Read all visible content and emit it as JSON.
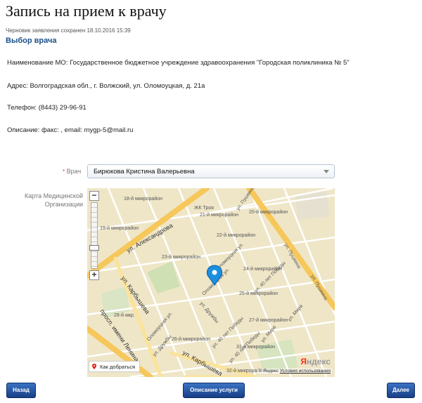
{
  "page": {
    "title": "Запись на прием к врачу",
    "draft_note": "Черновик заявления сохранен 18.10.2016 15:39",
    "section_title": "Выбор врача"
  },
  "clinic": {
    "name_line": "Наименование МО: Государственное бюджетное учреждение здравоохранения \"Городская поликлиника № 5\"",
    "address_line": "Адрес: Волгоградская обл., г. Волжский, ул. Оломоуцкая, д. 21а",
    "phone_line": "Телефон: (8443) 29-96-91",
    "description_line": "Описание: факс: , email: mygp-5@mail.ru"
  },
  "doctor_field": {
    "required_mark": "*",
    "label": "Врач",
    "value": "Бирюкова Кристина Валерьевна"
  },
  "map_section": {
    "label_line1": "Карта Медицинской",
    "label_line2": "Организации",
    "zoom_in": "+",
    "zoom_out": "−",
    "zoom_level_fraction": 0.7,
    "route_label": "Как добраться",
    "provider_prefix": "Я",
    "provider_rest": "ндекс",
    "copyright": "© Яндекс",
    "terms": "Условия использования",
    "labels": {
      "mkr18": "18-й микрорайон",
      "troya": "ЖК Троя",
      "mkr21": "21-й микрорайон",
      "mkr20": "20-й микрорайон",
      "mkr22": "22-й микрорайон",
      "mkr19": "19-й микрорайон",
      "mkr23": "23-й микрорайон",
      "mkr24": "24-й микрорайон",
      "mkr25": "25-й микрорайон",
      "mkr28": "28-й мкр.",
      "mkr27": "27-й микрорайон",
      "mkr26": "26-й микрорайон",
      "mkr31": "31-й микрорайон",
      "mkr32": "32-й микрорайон",
      "st_alexandrova": "ул. Александрова",
      "st_karbysheva": "ул. Карбышева",
      "st_karbysheva2": "ул. Карбышева",
      "st_lenina": "просп. имени Ленина",
      "st_pushkina": "ул. Пушкина",
      "st_pushkina2": "ул. Пушкина",
      "st_pushkina3": "ул. Пушкина",
      "st_olomouc": "Оломоуцкая ул.",
      "st_olomouc2": "Оломоуцкая ул.",
      "st_olomouc3": "Оломоуцкая ул.",
      "st_pobedy": "ул. 40 лет Победы",
      "st_pobedy2": "ул. 40 лет Победы",
      "st_pobedy3": "ул. 40 лет Победы",
      "st_druzhby": "ул. Дружбы",
      "st_druzhby2": "ул. Дружбы",
      "st_mira": "ул. Мира",
      "st_mira2": "ул. Мира"
    }
  },
  "buttons": {
    "back": "Назад",
    "service_description": "Описание услуги",
    "next": "Далее"
  },
  "colors": {
    "section_title": "#1b4f8a",
    "button_top": "#3b73c4",
    "button_bottom": "#173f86",
    "map_background": "#efe6c8",
    "major_road": "#f6c75a",
    "marker": "#1a8fe0"
  }
}
